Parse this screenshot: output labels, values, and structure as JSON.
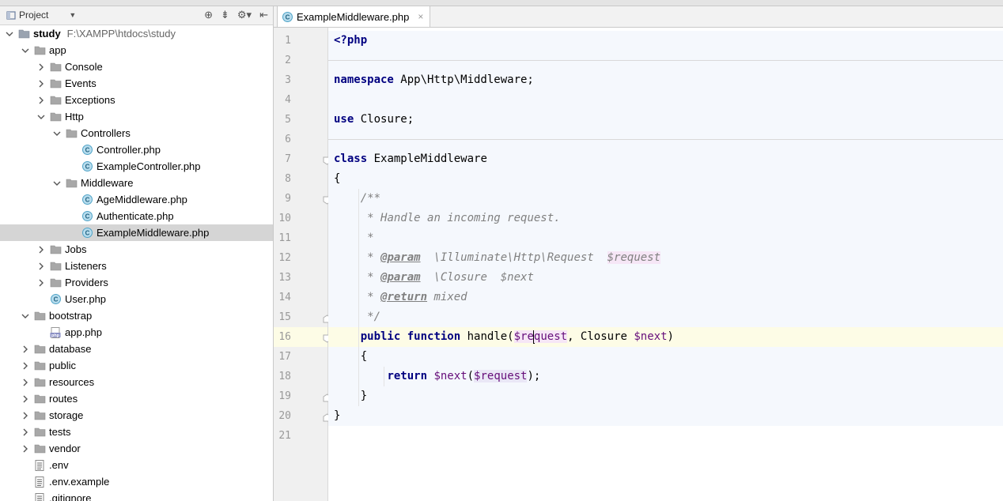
{
  "project_panel": {
    "title": "Project",
    "tree": [
      {
        "label": "study",
        "path": "F:\\XAMPP\\htdocs\\study",
        "type": "folder",
        "level": 0,
        "expanded": true,
        "root": true
      },
      {
        "label": "app",
        "type": "folder",
        "level": 1,
        "expanded": true
      },
      {
        "label": "Console",
        "type": "folder",
        "level": 2,
        "expanded": false
      },
      {
        "label": "Events",
        "type": "folder",
        "level": 2,
        "expanded": false
      },
      {
        "label": "Exceptions",
        "type": "folder",
        "level": 2,
        "expanded": false
      },
      {
        "label": "Http",
        "type": "folder",
        "level": 2,
        "expanded": true
      },
      {
        "label": "Controllers",
        "type": "folder",
        "level": 3,
        "expanded": true
      },
      {
        "label": "Controller.php",
        "type": "class",
        "level": 4
      },
      {
        "label": "ExampleController.php",
        "type": "class",
        "level": 4
      },
      {
        "label": "Middleware",
        "type": "folder",
        "level": 3,
        "expanded": true
      },
      {
        "label": "AgeMiddleware.php",
        "type": "class",
        "level": 4
      },
      {
        "label": "Authenticate.php",
        "type": "class",
        "level": 4
      },
      {
        "label": "ExampleMiddleware.php",
        "type": "class",
        "level": 4,
        "selected": true
      },
      {
        "label": "Jobs",
        "type": "folder",
        "level": 2,
        "expanded": false
      },
      {
        "label": "Listeners",
        "type": "folder",
        "level": 2,
        "expanded": false
      },
      {
        "label": "Providers",
        "type": "folder",
        "level": 2,
        "expanded": false
      },
      {
        "label": "User.php",
        "type": "class",
        "level": 2
      },
      {
        "label": "bootstrap",
        "type": "folder",
        "level": 1,
        "expanded": true
      },
      {
        "label": "app.php",
        "type": "php",
        "level": 2
      },
      {
        "label": "database",
        "type": "folder",
        "level": 1,
        "expanded": false
      },
      {
        "label": "public",
        "type": "folder",
        "level": 1,
        "expanded": false
      },
      {
        "label": "resources",
        "type": "folder",
        "level": 1,
        "expanded": false
      },
      {
        "label": "routes",
        "type": "folder",
        "level": 1,
        "expanded": false
      },
      {
        "label": "storage",
        "type": "folder",
        "level": 1,
        "expanded": false
      },
      {
        "label": "tests",
        "type": "folder",
        "level": 1,
        "expanded": false
      },
      {
        "label": "vendor",
        "type": "folder",
        "level": 1,
        "expanded": false
      },
      {
        "label": ".env",
        "type": "text",
        "level": 1
      },
      {
        "label": ".env.example",
        "type": "text",
        "level": 1
      },
      {
        "label": ".gitignore",
        "type": "text",
        "level": 1
      }
    ]
  },
  "editor": {
    "tab": {
      "label": "ExampleMiddleware.php",
      "close": "×"
    },
    "line_numbers": [
      "1",
      "2",
      "3",
      "4",
      "5",
      "6",
      "7",
      "8",
      "9",
      "10",
      "11",
      "12",
      "13",
      "14",
      "15",
      "16",
      "17",
      "18",
      "19",
      "20",
      "21"
    ],
    "lines": [
      {
        "t": [
          [
            "<?php",
            "tagc"
          ]
        ]
      },
      {
        "t": []
      },
      {
        "t": [
          [
            "namespace",
            "kw"
          ],
          [
            " App\\Http\\Middleware;",
            ""
          ]
        ]
      },
      {
        "t": []
      },
      {
        "t": [
          [
            "use",
            "kw"
          ],
          [
            " Closure;",
            ""
          ]
        ]
      },
      {
        "t": []
      },
      {
        "t": [
          [
            "class",
            "kw"
          ],
          [
            " ExampleMiddleware",
            ""
          ]
        ]
      },
      {
        "t": [
          [
            "{",
            ""
          ]
        ]
      },
      {
        "t": [
          [
            "    ",
            ""
          ],
          [
            "/**",
            "cm"
          ]
        ]
      },
      {
        "t": [
          [
            "     ",
            ""
          ],
          [
            "* Handle an incoming request.",
            "cm"
          ]
        ]
      },
      {
        "t": [
          [
            "     ",
            ""
          ],
          [
            "*",
            "cm"
          ]
        ]
      },
      {
        "t": [
          [
            "     ",
            ""
          ],
          [
            "* ",
            "cm"
          ],
          [
            "@param",
            "doctag"
          ],
          [
            "  \\Illuminate\\Http\\Request  ",
            "cm"
          ],
          [
            "$request",
            "cm hl-pink"
          ]
        ]
      },
      {
        "t": [
          [
            "     ",
            ""
          ],
          [
            "* ",
            "cm"
          ],
          [
            "@param",
            "doctag"
          ],
          [
            "  \\Closure  $next",
            "cm"
          ]
        ]
      },
      {
        "t": [
          [
            "     ",
            ""
          ],
          [
            "* ",
            "cm"
          ],
          [
            "@return",
            "doctag"
          ],
          [
            " mixed",
            "cm"
          ]
        ]
      },
      {
        "t": [
          [
            "     ",
            ""
          ],
          [
            "*/",
            "cm"
          ]
        ]
      },
      {
        "t": [
          [
            "    ",
            ""
          ],
          [
            "public",
            "kw"
          ],
          [
            " ",
            ""
          ],
          [
            "function",
            "kw"
          ],
          [
            " handle(",
            ""
          ],
          [
            "$re",
            "var hl-pink"
          ],
          [
            "CARET",
            ""
          ],
          [
            "quest",
            "var hl-pink"
          ],
          [
            ", Closure ",
            ""
          ],
          [
            "$next",
            "var"
          ],
          [
            ")",
            ""
          ]
        ]
      },
      {
        "t": [
          [
            "    {",
            ""
          ]
        ]
      },
      {
        "t": [
          [
            "        ",
            ""
          ],
          [
            "return",
            "kw"
          ],
          [
            " ",
            ""
          ],
          [
            "$next",
            "var"
          ],
          [
            "(",
            ""
          ],
          [
            "$request",
            "var hl-lilac"
          ],
          [
            ");",
            ""
          ]
        ]
      },
      {
        "t": [
          [
            "    }",
            ""
          ]
        ]
      },
      {
        "t": [
          [
            "}",
            ""
          ]
        ]
      },
      {
        "t": []
      }
    ]
  }
}
